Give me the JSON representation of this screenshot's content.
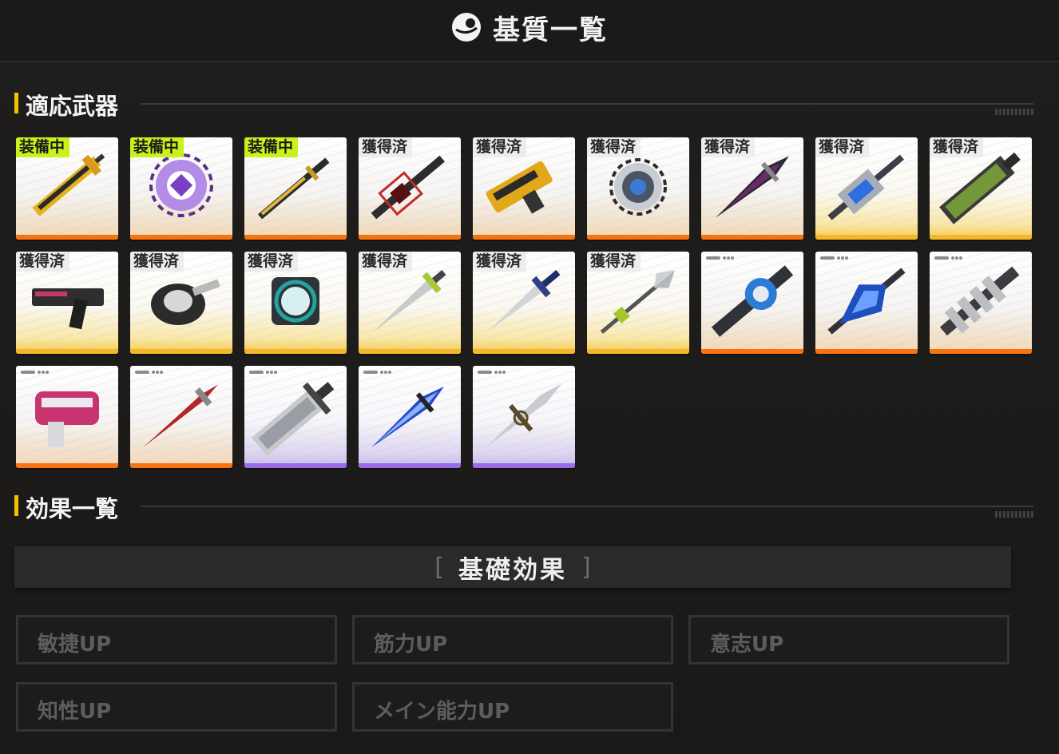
{
  "header": {
    "title": "基質一覧",
    "icon": "orb-icon"
  },
  "sections": {
    "weapons": "適応武器",
    "effects": "効果一覧"
  },
  "weapons": [
    {
      "badge": "装備中",
      "status": "equipped",
      "rarity": "orange",
      "art": "great-sword-yellow"
    },
    {
      "badge": "装備中",
      "status": "equipped",
      "rarity": "orange",
      "art": "crystal-core-purple"
    },
    {
      "badge": "装備中",
      "status": "equipped",
      "rarity": "orange",
      "art": "long-blade-gold"
    },
    {
      "badge": "獲得済",
      "status": "owned",
      "rarity": "orange",
      "art": "dark-sword-red"
    },
    {
      "badge": "獲得済",
      "status": "owned",
      "rarity": "orange",
      "art": "heavy-gun-yellow"
    },
    {
      "badge": "獲得済",
      "status": "owned",
      "rarity": "orange",
      "art": "gear-core-silver"
    },
    {
      "badge": "獲得済",
      "status": "owned",
      "rarity": "orange",
      "art": "dark-blade-purple"
    },
    {
      "badge": "獲得済",
      "status": "gold",
      "rarity": "gold",
      "art": "lance-blue"
    },
    {
      "badge": "獲得済",
      "status": "gold",
      "rarity": "gold",
      "art": "green-great-sword"
    },
    {
      "badge": "獲得済",
      "status": "owned",
      "rarity": "gold",
      "art": "pistol-dark"
    },
    {
      "badge": "獲得済",
      "status": "owned",
      "rarity": "gold",
      "art": "gauntlet-dark"
    },
    {
      "badge": "獲得済",
      "status": "owned",
      "rarity": "gold",
      "art": "core-teal"
    },
    {
      "badge": "獲得済",
      "status": "owned",
      "rarity": "gold",
      "art": "sword-lime"
    },
    {
      "badge": "獲得済",
      "status": "owned",
      "rarity": "gold",
      "art": "sword-navy"
    },
    {
      "badge": "獲得済",
      "status": "owned",
      "rarity": "gold",
      "art": "spear-lime"
    },
    {
      "badge": "",
      "status": "locked",
      "rarity": "orange",
      "art": "greatsword-blue-dial"
    },
    {
      "badge": "",
      "status": "locked",
      "rarity": "orange",
      "art": "crystal-sword-blue"
    },
    {
      "badge": "",
      "status": "locked",
      "rarity": "orange",
      "art": "chain-blade-grey"
    },
    {
      "badge": "",
      "status": "locked",
      "rarity": "orange",
      "art": "blaster-pink"
    },
    {
      "badge": "",
      "status": "locked",
      "rarity": "orange",
      "art": "long-sword-red"
    },
    {
      "badge": "",
      "status": "locked",
      "rarity": "purple",
      "art": "broad-sword-steel"
    },
    {
      "badge": "",
      "status": "locked",
      "rarity": "purple",
      "art": "sword-blue"
    },
    {
      "badge": "",
      "status": "locked",
      "rarity": "purple",
      "art": "cross-sword-steel"
    }
  ],
  "effects": {
    "category": "基礎効果",
    "bracket_open": "[",
    "bracket_close": "]",
    "options": [
      "敏捷UP",
      "筋力UP",
      "意志UP",
      "知性UP",
      "メイン能力UP"
    ]
  }
}
